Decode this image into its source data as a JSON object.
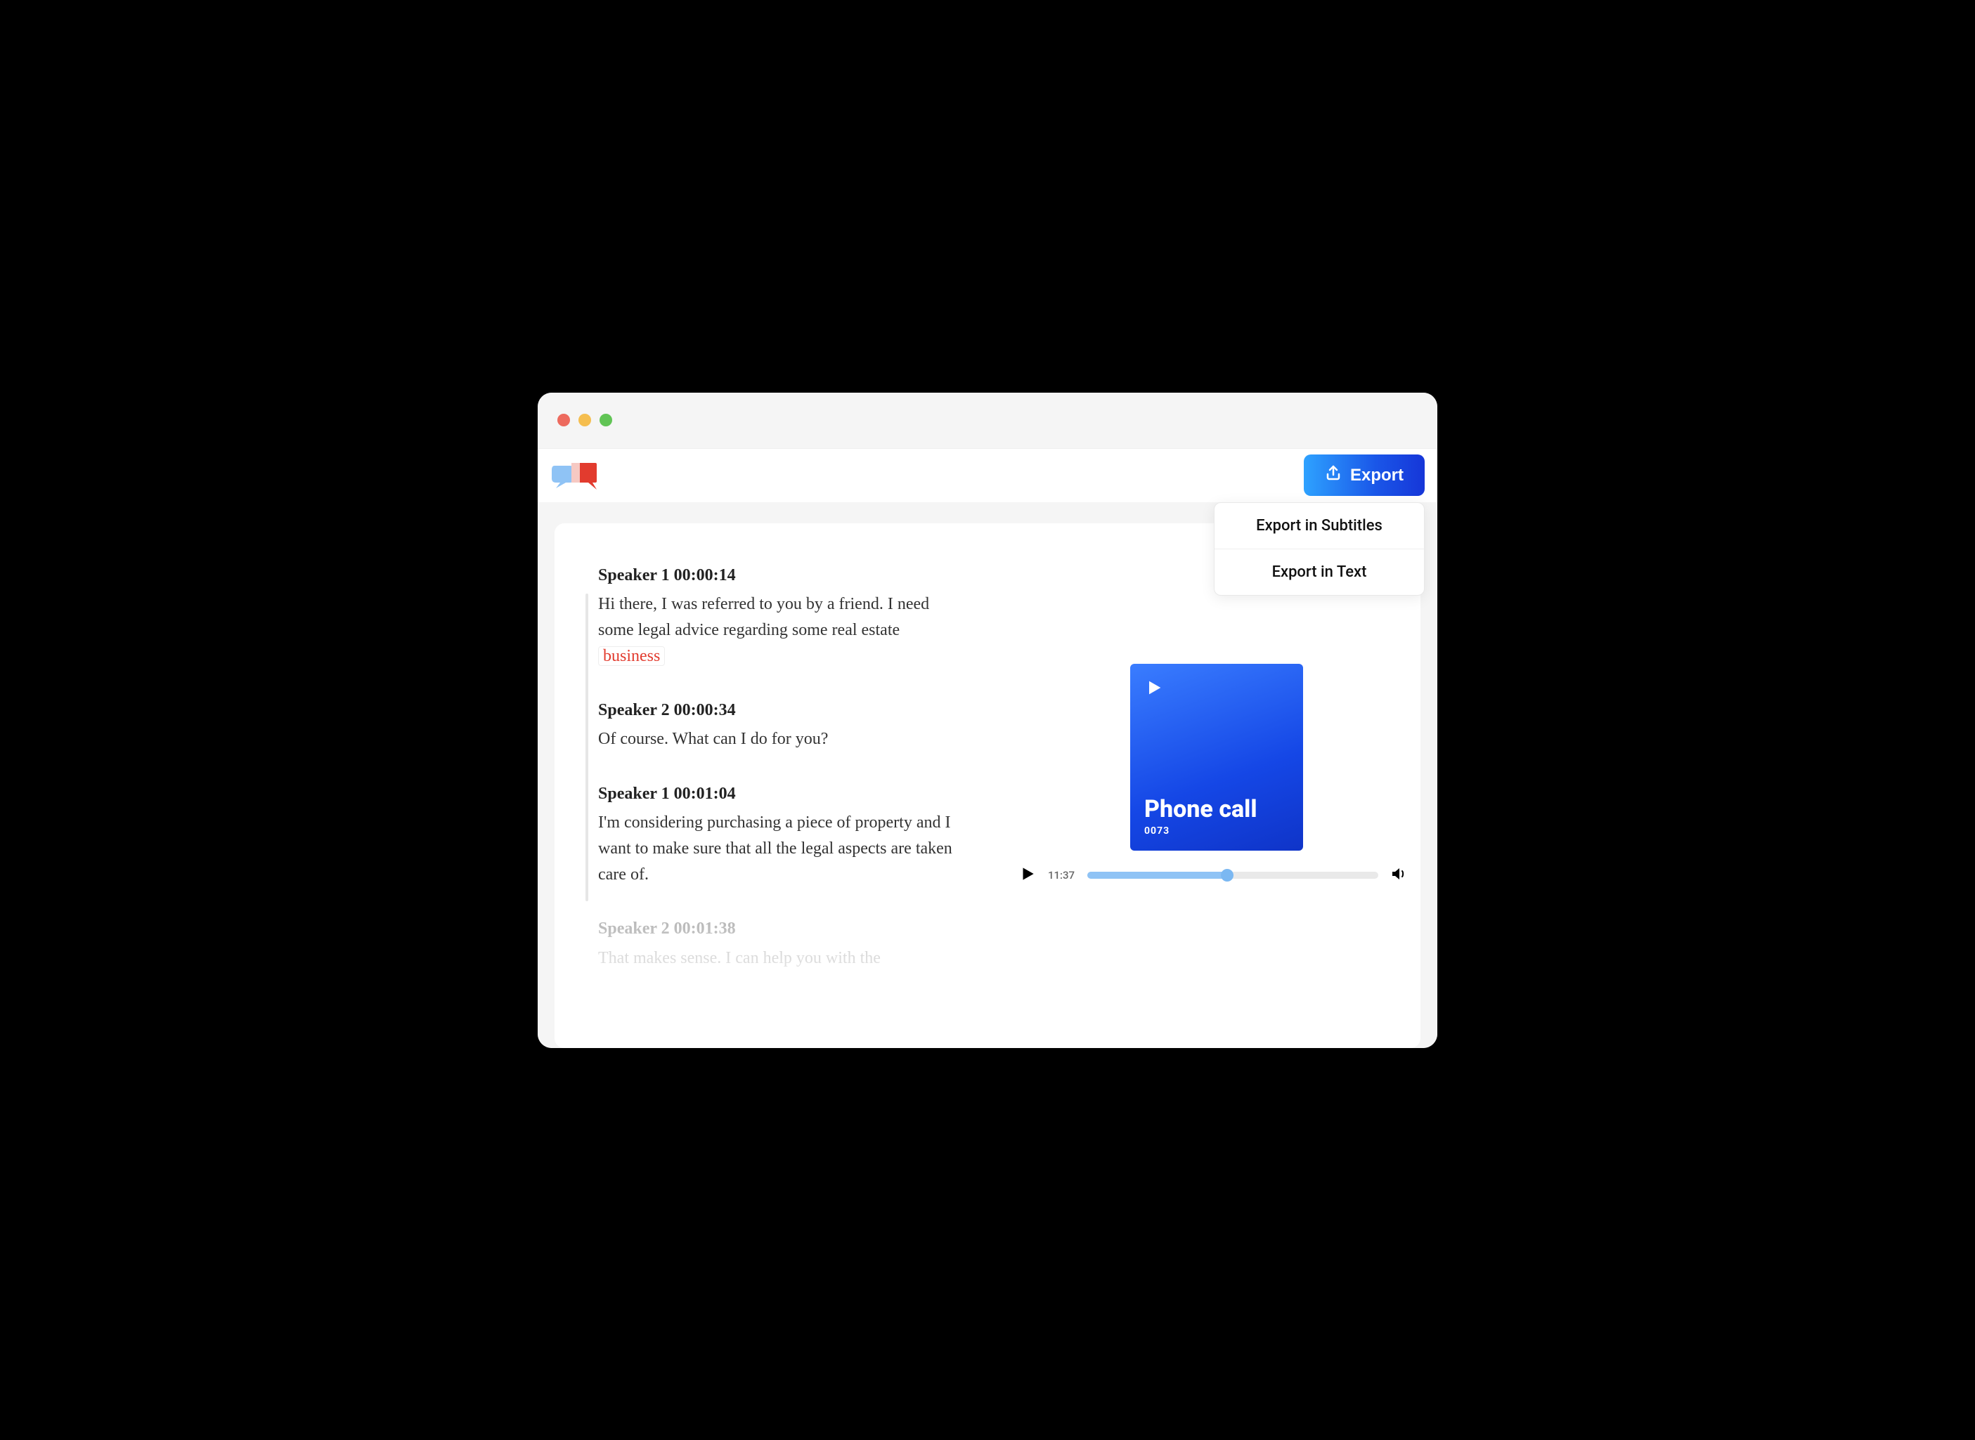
{
  "toolbar": {
    "export_label": "Export",
    "menu": {
      "subtitles": "Export in Subtitles",
      "text": "Export in Text"
    }
  },
  "transcript": {
    "segments": [
      {
        "speaker": "Speaker 1",
        "time": "00:00:14",
        "body_pre": "Hi there, I was referred to you by a friend. I need some legal advice regarding some real estate ",
        "highlight": "business",
        "body_post": ""
      },
      {
        "speaker": "Speaker 2",
        "time": "00:00:34",
        "body": "Of course. What can I do for you?"
      },
      {
        "speaker": "Speaker 1",
        "time": "00:01:04",
        "body": "I'm considering purchasing a piece of property and I want to make sure that all the legal aspects are taken care of."
      },
      {
        "speaker": "Speaker 2",
        "time": "00:01:38",
        "body": "That makes sense. I can help you with the"
      }
    ]
  },
  "player": {
    "cover_title": "Phone call",
    "cover_sub": "0073",
    "time_elapsed": "11:37",
    "progress_percent": 48
  }
}
